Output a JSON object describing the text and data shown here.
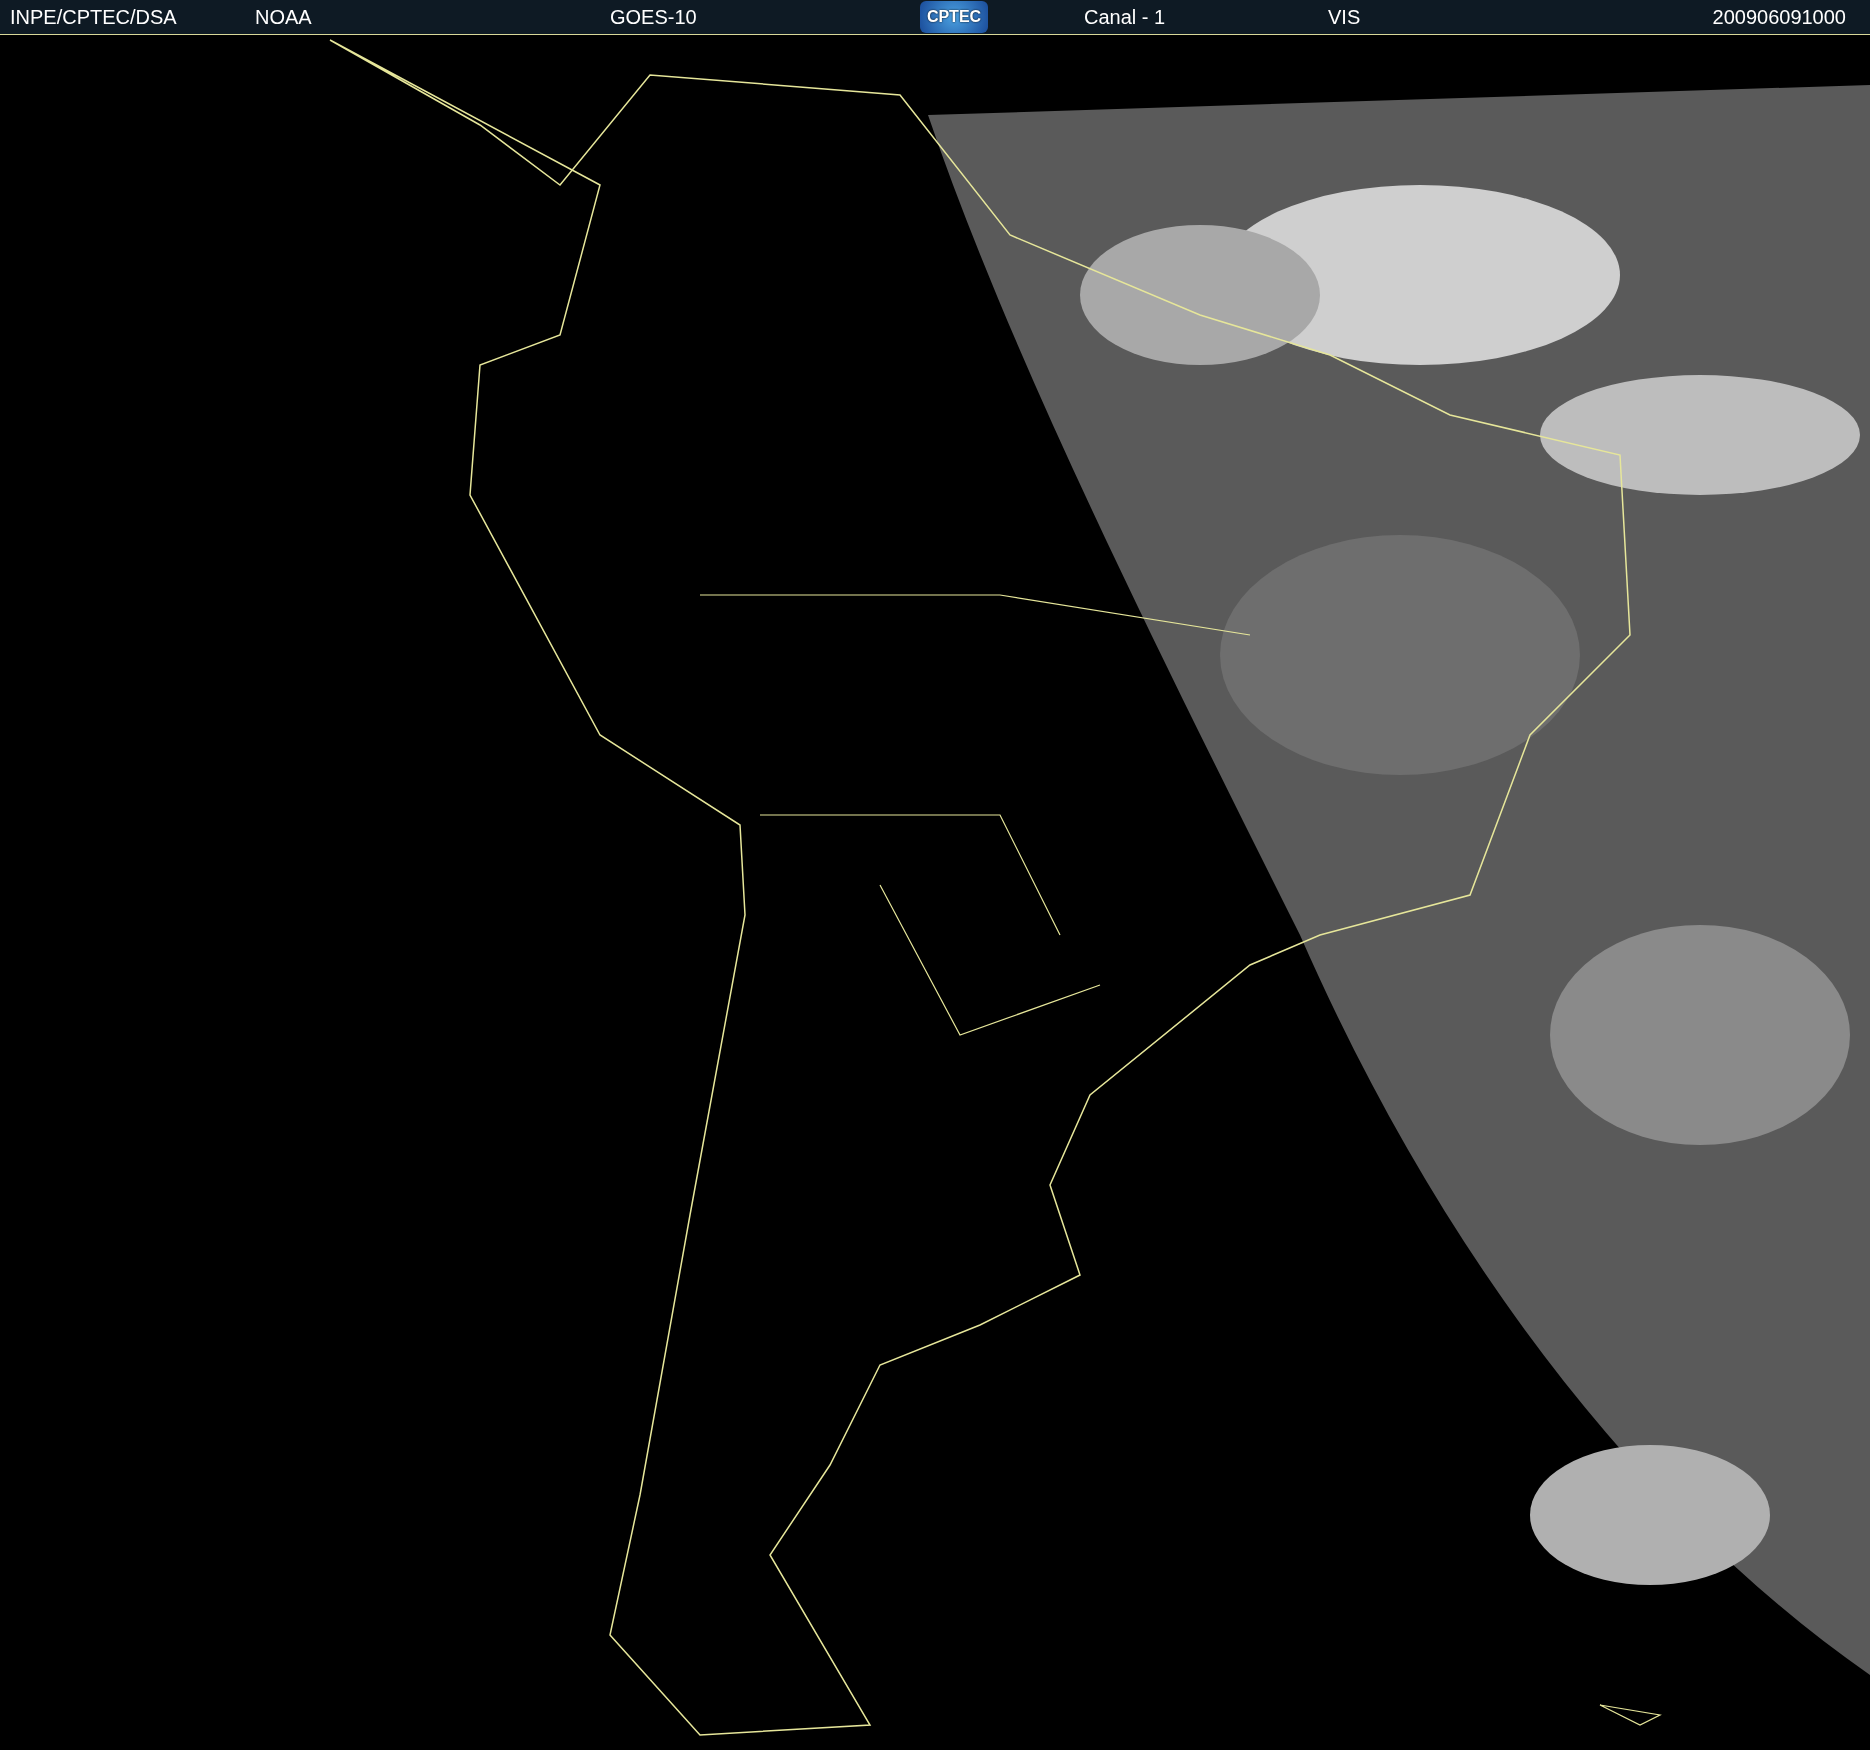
{
  "header": {
    "items": [
      {
        "kind": "text",
        "text": "INPE/CPTEC/DSA"
      },
      {
        "kind": "text",
        "text": "NOAA"
      },
      {
        "kind": "text",
        "text": "GOES-10"
      },
      {
        "kind": "logo",
        "text": "CPTEC"
      },
      {
        "kind": "text",
        "text": "Canal - 1"
      },
      {
        "kind": "text",
        "text": "VIS"
      },
      {
        "kind": "text",
        "text": "200906091000"
      }
    ]
  }
}
